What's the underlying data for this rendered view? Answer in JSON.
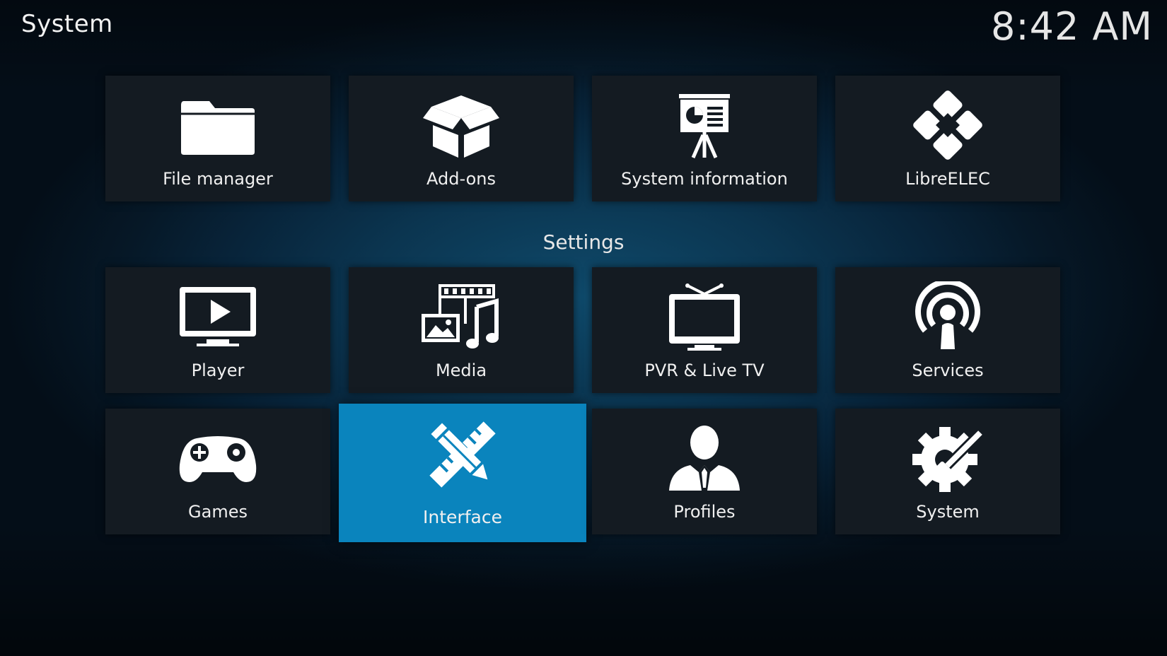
{
  "header": {
    "title": "System",
    "clock": "8:42 AM"
  },
  "section": {
    "title": "Settings"
  },
  "tiles": [
    {
      "label": "File manager",
      "icon": "folder-icon"
    },
    {
      "label": "Add-ons",
      "icon": "open-box-icon"
    },
    {
      "label": "System information",
      "icon": "presentation-board-icon"
    },
    {
      "label": "LibreELEC",
      "icon": "libreelec-logo-icon"
    },
    {
      "label": "Player",
      "icon": "play-monitor-icon"
    },
    {
      "label": "Media",
      "icon": "media-icon"
    },
    {
      "label": "PVR & Live TV",
      "icon": "tv-antenna-icon"
    },
    {
      "label": "Services",
      "icon": "broadcast-icon"
    },
    {
      "label": "Games",
      "icon": "gamepad-icon"
    },
    {
      "label": "Interface",
      "icon": "pencil-ruler-icon",
      "focused": true
    },
    {
      "label": "Profiles",
      "icon": "person-icon"
    },
    {
      "label": "System",
      "icon": "gear-wrench-icon"
    }
  ],
  "colors": {
    "focus": "#0a84bd",
    "tile": "#141b22",
    "background": "#0b3550"
  }
}
